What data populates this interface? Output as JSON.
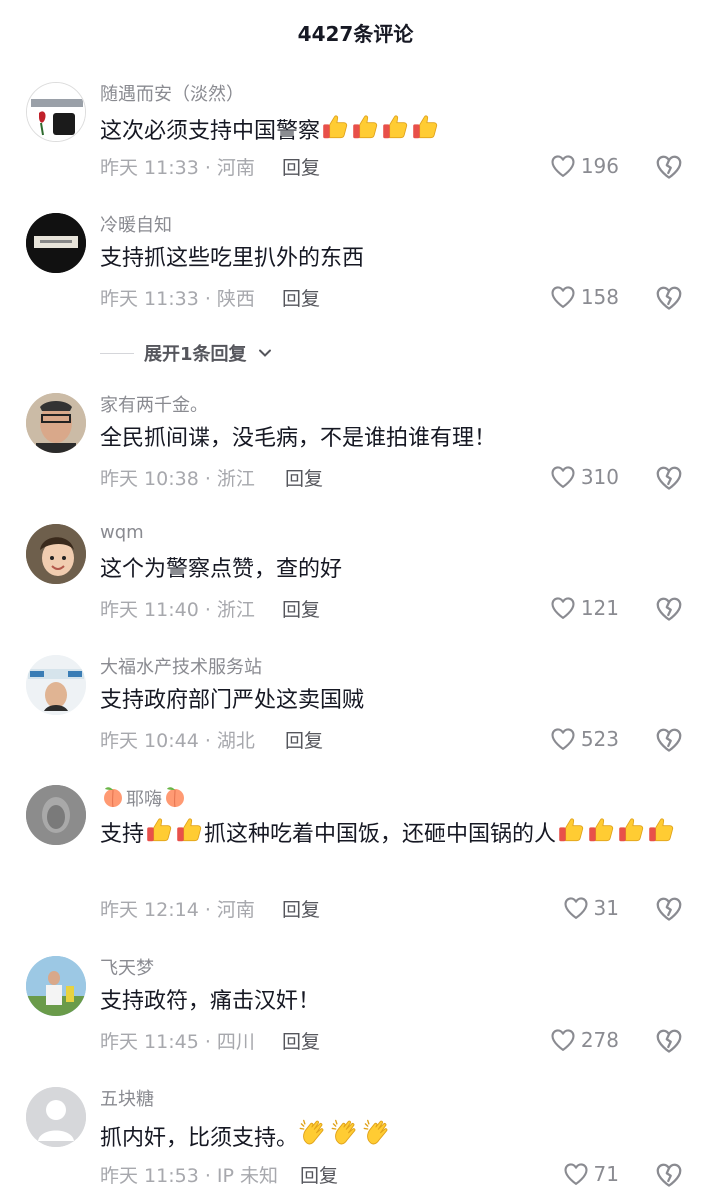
{
  "header": {
    "title": "4427条评论"
  },
  "comments": [
    {
      "user": "随遇而安（淡然）",
      "text": "这次必须支持中国警察",
      "emoji_tail": [
        "thumbs-up",
        "thumbs-up",
        "thumbs-up",
        "thumbs-up"
      ],
      "meta": "昨天 11:33 · 河南",
      "reply": "回复",
      "likes": "196"
    },
    {
      "user": "冷暖自知",
      "text": "支持抓这些吃里扒外的东西",
      "meta": "昨天 11:33 · 陕西",
      "reply": "回复",
      "likes": "158"
    },
    {
      "user": "家有两千金。",
      "text": "全民抓间谍，没毛病，不是谁拍谁有理！",
      "meta": "昨天 10:38 · 浙江",
      "reply": "回复",
      "likes": "310"
    },
    {
      "user": "wqm",
      "text": "这个为警察点赞，查的好",
      "meta": "昨天 11:40 · 浙江",
      "reply": "回复",
      "likes": "121"
    },
    {
      "user": "大福水产技术服务站",
      "text": "支持政府部门严处这卖国贼",
      "meta": "昨天 10:44 · 湖北",
      "reply": "回复",
      "likes": "523"
    },
    {
      "user": "耶嗨",
      "text_a": "支持",
      "text_b": "抓这种吃着中国饭，还砸中国锅的人",
      "meta": "昨天 12:14 · 河南",
      "reply": "回复",
      "likes": "31"
    },
    {
      "user": "飞天梦",
      "text": "支持政符，痛击汉奸！",
      "meta": "昨天 11:45 · 四川",
      "reply": "回复",
      "likes": "278"
    },
    {
      "user": "五块糖",
      "text": "抓内奸，比须支持。",
      "meta": "昨天 11:53 · IP 未知",
      "reply": "回复",
      "likes": "71"
    }
  ],
  "expand_replies": "展开1条回复",
  "icons": {
    "like": "heart-outline-icon",
    "dislike": "broken-heart-icon",
    "emoji": "thumbs-up-emoji",
    "clap": "clapping-hands-emoji",
    "peach": "peach-emoji"
  },
  "colors": {
    "text": "#161823",
    "secondary": "#8a8b91",
    "meta": "#a7a8ad"
  }
}
